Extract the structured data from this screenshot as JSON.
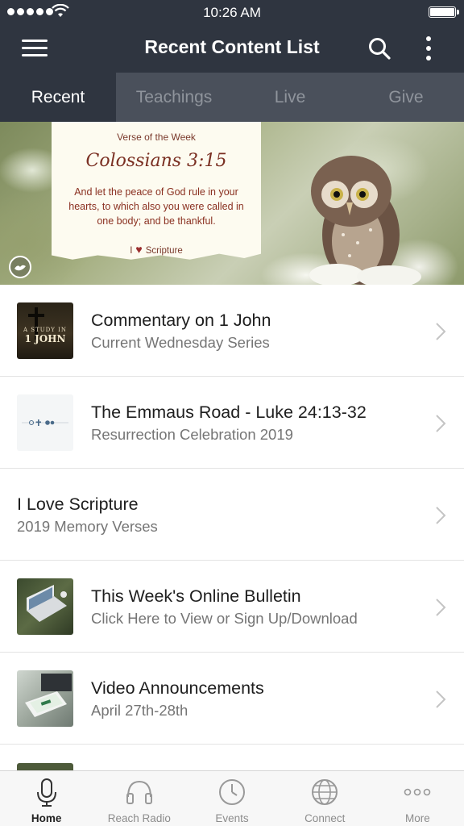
{
  "status_bar": {
    "time": "10:26 AM",
    "signal_icon": "signal-dots-icon",
    "wifi_icon": "wifi-icon",
    "battery_icon": "battery-icon"
  },
  "header": {
    "title": "Recent Content List",
    "menu_icon": "hamburger-icon",
    "search_icon": "search-icon",
    "more_icon": "kebab-icon",
    "background": "#2f3540"
  },
  "tabs": [
    {
      "label": "Recent",
      "active": true
    },
    {
      "label": "Teachings",
      "active": false
    },
    {
      "label": "Live",
      "active": false
    },
    {
      "label": "Give",
      "active": false
    }
  ],
  "banner": {
    "heading": "Verse of the Week",
    "reference": "Colossians 3:15",
    "verse": "And let the peace of God rule in your hearts, to which also you were called in one body; and be thankful.",
    "brand_prefix": "I",
    "brand_suffix": "Scripture"
  },
  "list": [
    {
      "title": "Commentary on 1 John",
      "subtitle": "Current Wednesday Series",
      "thumb_line1": "A STUDY IN",
      "thumb_line2": "1 JOHN"
    },
    {
      "title": "The Emmaus Road - Luke 24:13-32",
      "subtitle": "Resurrection Celebration 2019"
    },
    {
      "title": "I Love Scripture",
      "subtitle": "2019 Memory Verses"
    },
    {
      "title": "This Week's Online Bulletin",
      "subtitle": "Click Here to View or Sign Up/Download"
    },
    {
      "title": "Video Announcements",
      "subtitle": "April 27th-28th"
    }
  ],
  "bottom_nav": [
    {
      "label": "Home",
      "icon": "microphone-icon",
      "active": true
    },
    {
      "label": "Reach Radio",
      "icon": "headphones-icon",
      "active": false
    },
    {
      "label": "Events",
      "icon": "clock-icon",
      "active": false
    },
    {
      "label": "Connect",
      "icon": "globe-icon",
      "active": false
    },
    {
      "label": "More",
      "icon": "ellipsis-icon",
      "active": false
    }
  ],
  "colors": {
    "header_bg": "#2f3540",
    "tab_bar_bg": "#4a505b",
    "accent_text": "#7a2f22"
  }
}
